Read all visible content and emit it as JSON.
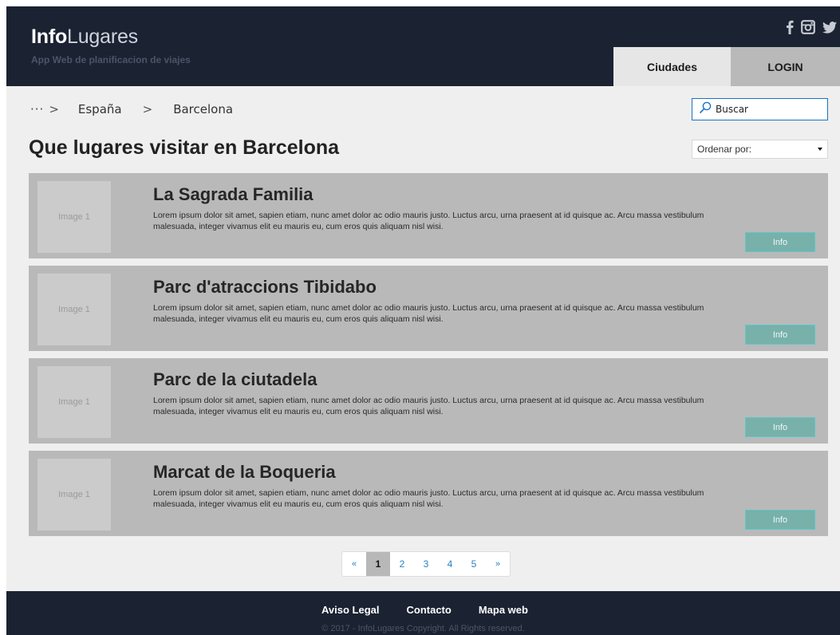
{
  "header": {
    "brand_bold": "Info",
    "brand_light": "Lugares",
    "tagline": "App Web de planificacion de viajes",
    "social_icons": [
      "facebook-icon",
      "instagram-icon",
      "twitter-icon"
    ],
    "nav": {
      "cities": "Ciudades",
      "login": "LOGIN"
    }
  },
  "breadcrumb": {
    "ellipsis": "···",
    "separator": ">",
    "items": [
      "España",
      "Barcelona"
    ]
  },
  "search": {
    "placeholder": "Buscar"
  },
  "main": {
    "title": "Que lugares visitar en Barcelona",
    "sort_label": "Ordenar por:"
  },
  "places": [
    {
      "image_label": "Image 1",
      "title": "La Sagrada Familia",
      "description": "Lorem ipsum dolor sit amet, sapien etiam, nunc amet dolor ac odio mauris justo. Luctus arcu, urna praesent at id quisque ac. Arcu massa vestibulum malesuada, integer vivamus elit eu mauris eu, cum eros quis aliquam nisl wisi.",
      "button": "Info"
    },
    {
      "image_label": "Image 1",
      "title": "Parc d'atraccions Tibidabo",
      "description": "Lorem ipsum dolor sit amet, sapien etiam, nunc amet dolor ac odio mauris justo. Luctus arcu, urna praesent at id quisque ac. Arcu massa vestibulum malesuada, integer vivamus elit eu mauris eu, cum eros quis aliquam nisl wisi.",
      "button": "Info"
    },
    {
      "image_label": "Image 1",
      "title": "Parc de la ciutadela",
      "description": "Lorem ipsum dolor sit amet, sapien etiam, nunc amet dolor ac odio mauris justo. Luctus arcu, urna praesent at id quisque ac. Arcu massa vestibulum malesuada, integer vivamus elit eu mauris eu, cum eros quis aliquam nisl wisi.",
      "button": "Info"
    },
    {
      "image_label": "Image 1",
      "title": "Marcat de la Boqueria",
      "description": "Lorem ipsum dolor sit amet, sapien etiam, nunc amet dolor ac odio mauris justo. Luctus arcu, urna praesent at id quisque ac. Arcu massa vestibulum malesuada, integer vivamus elit eu mauris eu, cum eros quis aliquam nisl wisi.",
      "button": "Info"
    }
  ],
  "pagination": {
    "prev": "«",
    "pages": [
      "1",
      "2",
      "3",
      "4",
      "5"
    ],
    "next": "»",
    "current": "1"
  },
  "footer": {
    "links": [
      "Aviso Legal",
      "Contacto",
      "Mapa web"
    ],
    "copyright": "© 2017 - InfoLugares Copyright. All Rights reserved."
  },
  "colors": {
    "header_bg": "#1b2232",
    "page_bg": "#efefef",
    "card_bg": "#b9b9b9",
    "info_button": "#77b1a9",
    "accent_blue": "#1a73c7"
  }
}
